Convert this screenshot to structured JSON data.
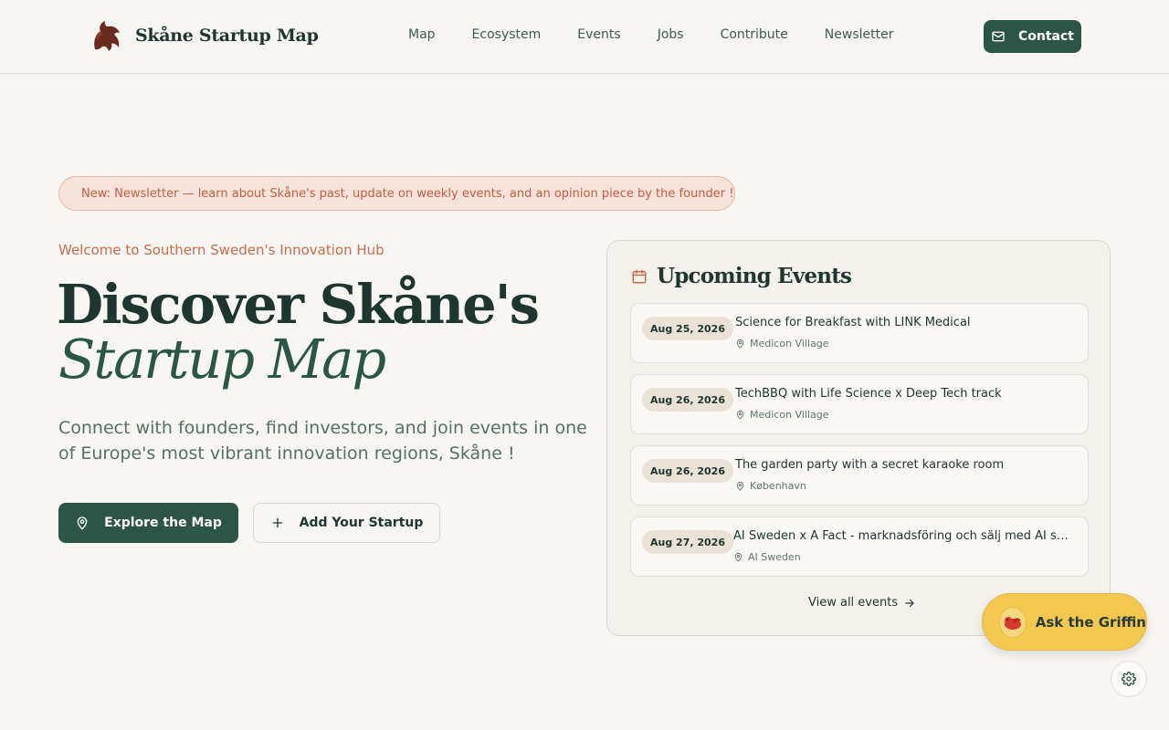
{
  "header": {
    "brand": "Skåne Startup Map",
    "nav": [
      "Map",
      "Ecosystem",
      "Events",
      "Jobs",
      "Contribute",
      "Newsletter"
    ],
    "contact_label": "Contact"
  },
  "announcement": {
    "text": "New: Newsletter — learn about Skåne's past, update on weekly events, and an opinion piece by the founder !"
  },
  "hero": {
    "eyebrow": "Welcome to Southern Sweden's Innovation Hub",
    "title_line1": "Discover Skåne's",
    "title_line2": "Startup Map",
    "subtitle": "Connect with founders, find investors, and join events in one of Europe's most vibrant innovation regions, Skåne !",
    "primary_cta": "Explore the Map",
    "secondary_cta": "Add Your Startup"
  },
  "events": {
    "heading": "Upcoming Events",
    "items": [
      {
        "date": "Aug 25, 2026",
        "title": "Science for Breakfast with LINK Medical",
        "location": "Medicon Village"
      },
      {
        "date": "Aug 26, 2026",
        "title": "TechBBQ with Life Science x Deep Tech track",
        "location": "Medicon Village"
      },
      {
        "date": "Aug 26, 2026",
        "title": "The garden party with a secret karaoke room",
        "location": "København"
      },
      {
        "date": "Aug 27, 2026",
        "title": "AI Sweden x A Fact - marknadsföring och sälj med AI som...",
        "location": "AI Sweden"
      }
    ],
    "view_all": "View all events"
  },
  "assistant": {
    "label": "Ask the Griffin"
  },
  "icons": {
    "brand": "griffin-logo-icon",
    "contact": "mail-icon",
    "announcement": "mail-icon",
    "announcement_arrow": "arrow-right-icon",
    "explore": "map-pin-icon",
    "add": "plus-icon",
    "events": "calendar-icon",
    "location": "map-pin-icon",
    "settings": "gear-icon"
  },
  "colors": {
    "background": "#f8f6f2",
    "primary": "#2b5647",
    "accent": "#c86c4c",
    "assistant": "#f2c84e"
  }
}
